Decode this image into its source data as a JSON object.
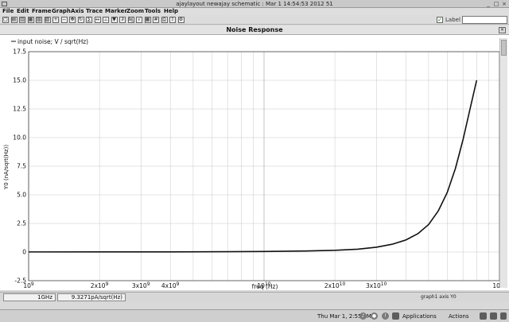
{
  "window": {
    "title": "ajaylayout newajay schematic : Mar  1 14:54:53 2012 51"
  },
  "menu": [
    "File",
    "Edit",
    "Frame",
    "Graph",
    "Axis",
    "Trace",
    "Marker",
    "Zoom",
    "Tools",
    "Help"
  ],
  "toolbar": {
    "label_text": "Label",
    "label_checked": true,
    "tool_icons": [
      "new-window-icon",
      "open-icon",
      "stack-icon",
      "strip-icon",
      "separate-icon",
      "zoom-fit-icon",
      "zoom-in-icon",
      "zoom-out-icon",
      "pan-icon",
      "reload-icon",
      "calculator-icon",
      "measure-icon",
      "axis-icon",
      "marker-icon",
      "dy-dx-icon",
      "log-axis-icon",
      "sqrt-axis-icon",
      "table-icon",
      "grid-icon",
      "print-icon",
      "export-icon",
      "settings-icon"
    ]
  },
  "panel": {
    "title": "Noise Response"
  },
  "status": {
    "x_value": "1GHz",
    "y_value": "9.3271pA/sqrt(Hz)",
    "axis_label": "graph1 axis Y0"
  },
  "taskbar": {
    "clock": "Thu Mar  1,  2:55 PM",
    "applications": "Applications",
    "actions": "Actions"
  },
  "colors": {
    "trace": "#111111",
    "grid": "#c8c8c8",
    "plot_bg": "#ffffff"
  },
  "chart_data": {
    "type": "line",
    "legend_entry": "input noise; V / sqrt(Hz)",
    "xlabel": "freq (Hz)",
    "ylabel": "Y0 (nA/sqrt(Hz))",
    "x_scale": "log",
    "xlim": [
      1000000000.0,
      100000000000.0
    ],
    "ylim": [
      -2.5,
      17.5
    ],
    "y_ticks": [
      -2.5,
      0,
      2.5,
      5.0,
      7.5,
      10.0,
      12.5,
      15.0,
      17.5
    ],
    "y_tick_labels": [
      "-2.5",
      "0",
      "2.5",
      "5.0",
      "7.5",
      "10.0",
      "12.5",
      "15.0",
      "17.5"
    ],
    "x_major_ticks": [
      {
        "value": 1000000000.0,
        "mantissa": "10",
        "exp": "9"
      },
      {
        "value": 10000000000.0,
        "mantissa": "10",
        "exp": "10"
      },
      {
        "value": 100000000000.0,
        "mantissa": "10",
        "exp": "11"
      }
    ],
    "x_minor_labels": [
      {
        "value": 2000000000.0,
        "mantissa": "2x10",
        "exp": "9"
      },
      {
        "value": 3000000000.0,
        "mantissa": "3x10",
        "exp": "9"
      },
      {
        "value": 4000000000.0,
        "mantissa": "4x10",
        "exp": "9"
      },
      {
        "value": 20000000000.0,
        "mantissa": "2x10",
        "exp": "10"
      },
      {
        "value": 30000000000.0,
        "mantissa": "3x10",
        "exp": "10"
      }
    ],
    "grid": true,
    "series": [
      {
        "name": "input noise; V / sqrt(Hz)",
        "x": [
          1000000000.0,
          2000000000.0,
          4000000000.0,
          7000000000.0,
          10000000000.0,
          15000000000.0,
          20000000000.0,
          25000000000.0,
          30000000000.0,
          35000000000.0,
          40000000000.0,
          45000000000.0,
          50000000000.0,
          55000000000.0,
          60000000000.0,
          65000000000.0,
          70000000000.0,
          75000000000.0,
          80000000000.0
        ],
        "y": [
          0.0093,
          0.0105,
          0.016,
          0.03,
          0.05,
          0.09,
          0.15,
          0.25,
          0.42,
          0.68,
          1.05,
          1.6,
          2.4,
          3.6,
          5.2,
          7.3,
          9.8,
          12.5,
          15.0
        ]
      }
    ]
  }
}
